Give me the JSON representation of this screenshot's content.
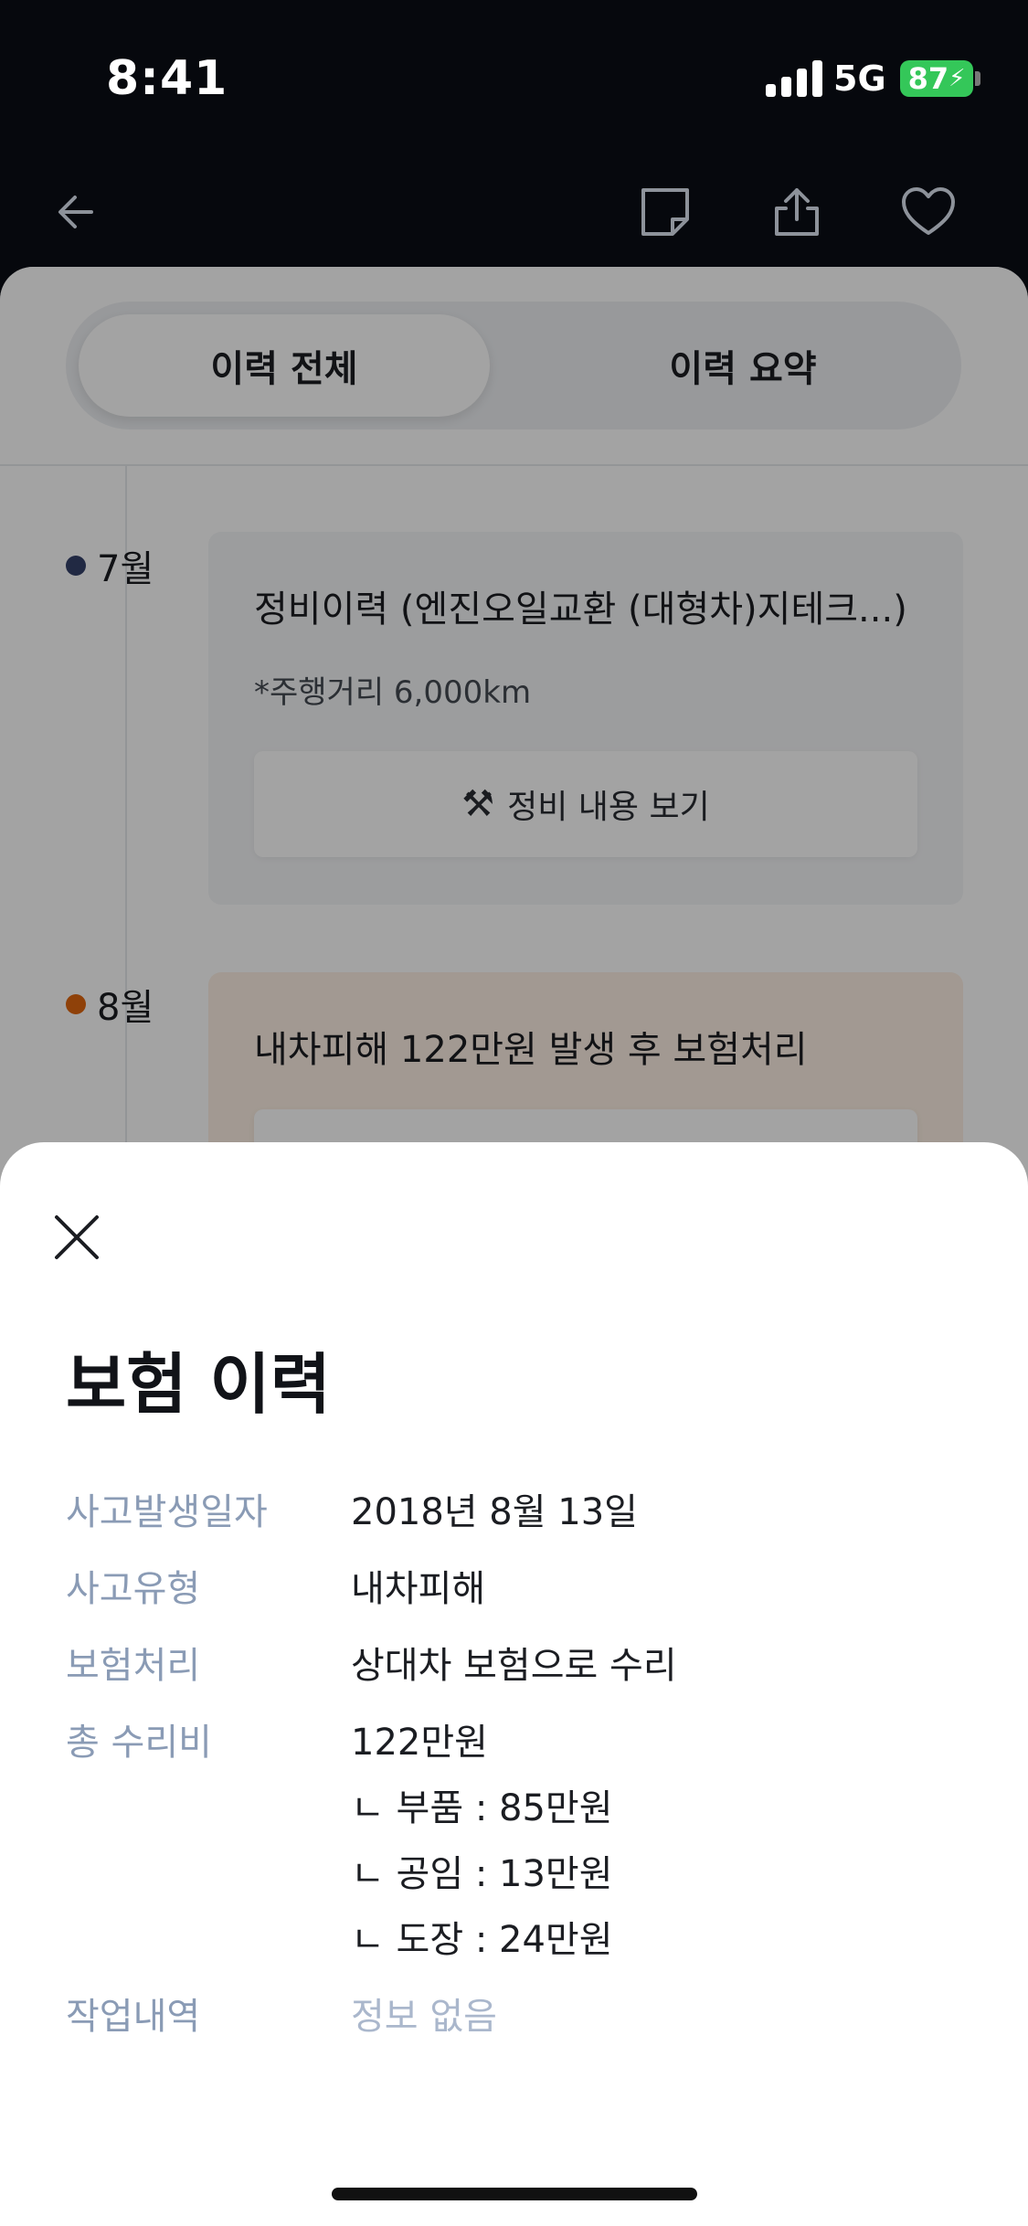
{
  "status": {
    "time": "8:41",
    "network": "5G",
    "battery": "87"
  },
  "nav": {
    "back_icon": "arrow-left-icon",
    "memo_icon": "note-icon",
    "share_icon": "share-icon",
    "like_icon": "heart-icon"
  },
  "tabs": [
    {
      "label": "이력 전체",
      "active": true
    },
    {
      "label": "이력 요약",
      "active": false
    }
  ],
  "timeline": [
    {
      "month": "7월",
      "dot_color": "#34406a",
      "title": "정비이력 (엔진오일교환 (대형차)지테크...)",
      "sub": "*주행거리 6,000km",
      "button_label": "정비 내용 보기",
      "button_icon": "tools-icon"
    },
    {
      "month": "8월",
      "dot_color": "#e0660f",
      "title": "내차피해 122만원 발생 후 보험처리"
    }
  ],
  "sheet": {
    "close_icon": "close-icon",
    "title": "보험 이력",
    "rows": [
      {
        "label": "사고발생일자",
        "values": [
          "2018년 8월 13일"
        ]
      },
      {
        "label": "사고유형",
        "values": [
          "내차피해"
        ]
      },
      {
        "label": "보험처리",
        "values": [
          "상대차 보험으로 수리"
        ]
      },
      {
        "label": "총 수리비",
        "values": [
          "122만원",
          "ㄴ 부품 : 85만원",
          "ㄴ 공임 : 13만원",
          "ㄴ 도장 : 24만원"
        ]
      },
      {
        "label": "작업내역",
        "values": [
          "정보 없음"
        ]
      }
    ]
  }
}
